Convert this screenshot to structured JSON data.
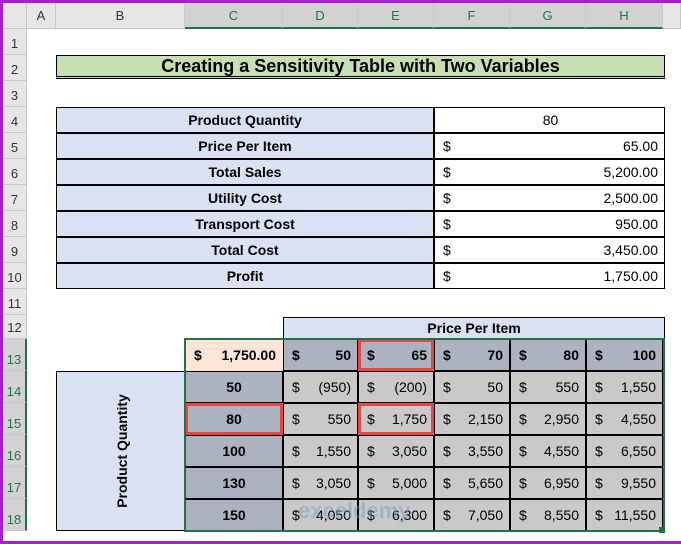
{
  "columns": [
    "A",
    "B",
    "C",
    "D",
    "E",
    "F",
    "G",
    "H"
  ],
  "rows": [
    "1",
    "2",
    "3",
    "4",
    "5",
    "6",
    "7",
    "8",
    "9",
    "10",
    "11",
    "12",
    "13",
    "14",
    "15",
    "16",
    "17",
    "18"
  ],
  "title": "Creating a Sensitivity Table with Two Variables",
  "info": [
    {
      "label": "Product Quantity",
      "value": "80",
      "currency": ""
    },
    {
      "label": "Price Per Item",
      "value": "65.00",
      "currency": "$"
    },
    {
      "label": "Total Sales",
      "value": "5,200.00",
      "currency": "$"
    },
    {
      "label": "Utility Cost",
      "value": "2,500.00",
      "currency": "$"
    },
    {
      "label": "Transport Cost",
      "value": "950.00",
      "currency": "$"
    },
    {
      "label": "Total Cost",
      "value": "3,450.00",
      "currency": "$"
    },
    {
      "label": "Profit",
      "value": "1,750.00",
      "currency": "$"
    }
  ],
  "sensitivity": {
    "col_header": "Price Per Item",
    "row_header": "Product Quantity",
    "corner": "1,750.00",
    "currency": "$",
    "prices": [
      "50",
      "65",
      "70",
      "80",
      "100"
    ],
    "quantities": [
      "50",
      "80",
      "100",
      "130",
      "150"
    ],
    "values": [
      [
        "(950)",
        "(200)",
        "50",
        "550",
        "1,550"
      ],
      [
        "550",
        "1,750",
        "2,150",
        "2,950",
        "4,550"
      ],
      [
        "1,550",
        "3,050",
        "3,550",
        "4,550",
        "6,550"
      ],
      [
        "3,050",
        "5,000",
        "5,650",
        "6,950",
        "9,550"
      ],
      [
        "4,050",
        "6,300",
        "7,050",
        "8,550",
        "11,550"
      ]
    ]
  },
  "watermark": "exceldemy",
  "colors": {
    "title_bg": "#c6e0b4",
    "label_bg": "#d9e1f2",
    "corner_bg": "#fce4d6",
    "axis_bg": "#acb2c0",
    "body_bg": "#c9c9c9",
    "highlight": "#e84545",
    "selection": "#217346"
  }
}
